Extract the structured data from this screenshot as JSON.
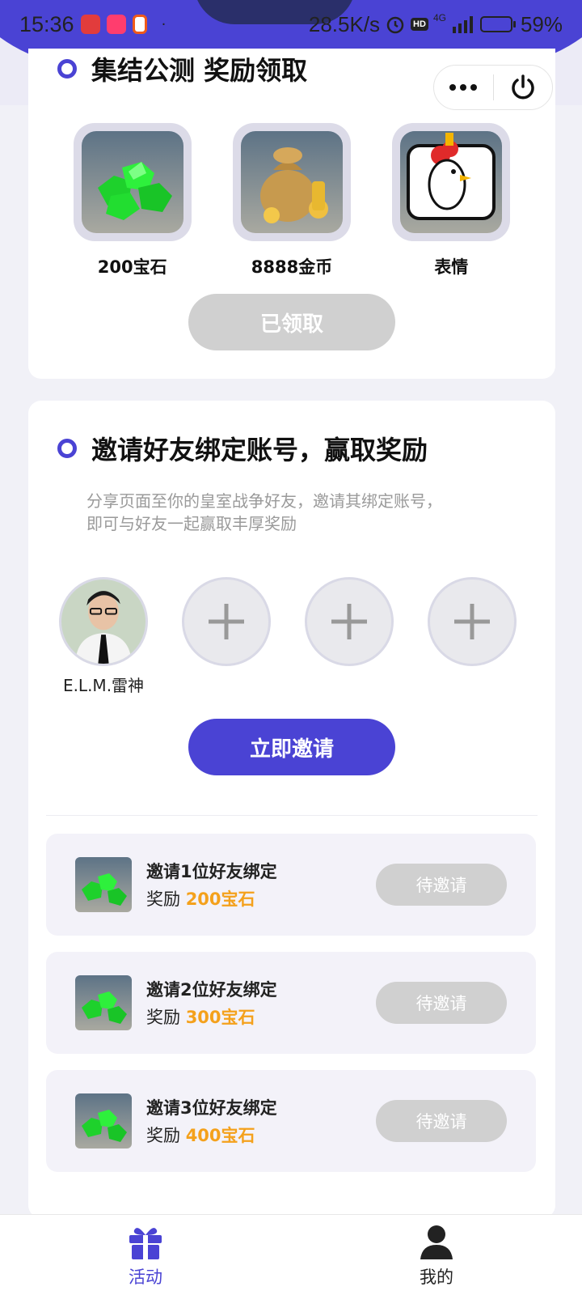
{
  "status_bar": {
    "time": "15:36",
    "dot": "·",
    "network_speed": "28.5K/s",
    "signal_label": "4G",
    "battery_percent": "59%",
    "battery_level": 0.59,
    "hd_label": "HD"
  },
  "capsule": {
    "more_icon": "more-dots-icon",
    "close_icon": "power-icon"
  },
  "rewards_section": {
    "title": "集结公测 奖励领取",
    "items": [
      {
        "label": "200宝石",
        "icon": "green-gems-icon"
      },
      {
        "label": "8888金币",
        "icon": "gold-bag-icon"
      },
      {
        "label": "表情",
        "icon": "chicken-emote-icon"
      }
    ],
    "claim_button": "已领取"
  },
  "invite_section": {
    "title": "邀请好友绑定账号，赢取奖励",
    "description_line1": "分享页面至你的皇室战争好友，邀请其绑定账号，",
    "description_line2": "即可与好友一起赢取丰厚奖励",
    "friends": [
      {
        "name": "E.L.M.雷神",
        "filled": true
      },
      {
        "name": "",
        "filled": false
      },
      {
        "name": "",
        "filled": false
      },
      {
        "name": "",
        "filled": false
      }
    ],
    "invite_button": "立即邀请",
    "tasks": [
      {
        "title": "邀请1位好友绑定",
        "reward_prefix": "奖励 ",
        "reward_amount": "200宝石",
        "status": "待邀请"
      },
      {
        "title": "邀请2位好友绑定",
        "reward_prefix": "奖励 ",
        "reward_amount": "300宝石",
        "status": "待邀请"
      },
      {
        "title": "邀请3位好友绑定",
        "reward_prefix": "奖励 ",
        "reward_amount": "400宝石",
        "status": "待邀请"
      }
    ]
  },
  "tabbar": {
    "tabs": [
      {
        "label": "活动",
        "icon": "gift-icon",
        "active": true
      },
      {
        "label": "我的",
        "icon": "user-icon",
        "active": false
      }
    ]
  },
  "colors": {
    "primary": "#4a43d4",
    "accent": "#f4a11c",
    "disabled": "#d0d0d0"
  }
}
